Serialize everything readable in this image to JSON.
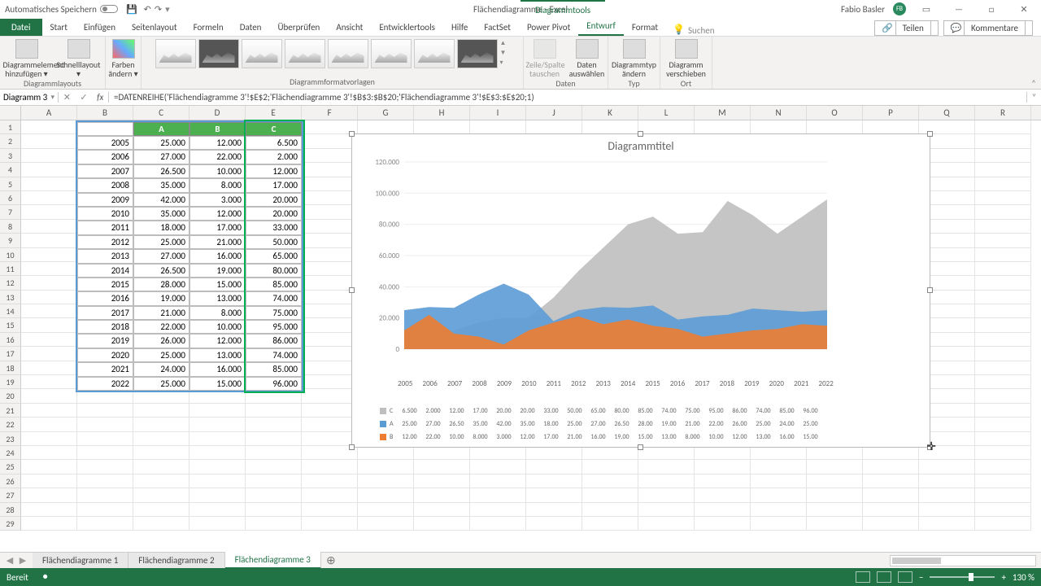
{
  "titlebar": {
    "autosave": "Automatisches Speichern",
    "title": "Flächendiagramme - Excel",
    "tools_tab": "Diagrammtools",
    "user": "Fabio Basler",
    "avatar": "FB"
  },
  "ribbon": {
    "tabs": [
      "Datei",
      "Start",
      "Einfügen",
      "Seitenlayout",
      "Formeln",
      "Daten",
      "Überprüfen",
      "Ansicht",
      "Entwicklertools",
      "Hilfe",
      "FactSet",
      "Power Pivot",
      "Entwurf",
      "Format"
    ],
    "active_tab": "Entwurf",
    "search": "Suchen",
    "share": "Teilen",
    "comments": "Kommentare",
    "groups": {
      "layouts": "Diagrammlayouts",
      "styles": "Diagrammformatvorlagen",
      "data": "Daten",
      "type": "Typ",
      "location": "Ort",
      "btn_addelement": "Diagrammelement hinzufügen",
      "btn_quicklayout": "Schnelllayout",
      "btn_colors": "Farben ändern",
      "btn_switch": "Zeile/Spalte tauschen",
      "btn_select": "Daten auswählen",
      "btn_changetype": "Diagrammtyp ändern",
      "btn_move": "Diagramm verschieben"
    }
  },
  "namebox": "Diagramm 3",
  "formula": "=DATENREIHE('Flächendiagramme 3'!$E$2;'Flächendiagramme 3'!$B$3:$B$20;'Flächendiagramme 3'!$E$3:$E$20;1)",
  "columns": [
    "A",
    "B",
    "C",
    "D",
    "E",
    "F",
    "G",
    "H",
    "I",
    "J",
    "K",
    "L",
    "M",
    "N",
    "O",
    "P",
    "Q",
    "R"
  ],
  "table": {
    "headers": [
      "A",
      "B",
      "C"
    ],
    "years": [
      2005,
      2006,
      2007,
      2008,
      2009,
      2010,
      2011,
      2012,
      2013,
      2014,
      2015,
      2016,
      2017,
      2018,
      2019,
      2020,
      2021,
      2022
    ],
    "A": [
      "25.000",
      "27.000",
      "26.500",
      "35.000",
      "42.000",
      "35.000",
      "18.000",
      "25.000",
      "27.000",
      "26.500",
      "28.000",
      "19.000",
      "21.000",
      "22.000",
      "26.000",
      "25.000",
      "24.000",
      "25.000"
    ],
    "B": [
      "12.000",
      "22.000",
      "10.000",
      "8.000",
      "3.000",
      "12.000",
      "17.000",
      "21.000",
      "16.000",
      "19.000",
      "15.000",
      "13.000",
      "8.000",
      "10.000",
      "12.000",
      "13.000",
      "16.000",
      "15.000"
    ],
    "C": [
      "6.500",
      "2.000",
      "12.000",
      "17.000",
      "20.000",
      "20.000",
      "33.000",
      "50.000",
      "65.000",
      "80.000",
      "85.000",
      "74.000",
      "75.000",
      "95.000",
      "86.000",
      "74.000",
      "85.000",
      "96.000"
    ]
  },
  "chart_data": {
    "type": "area",
    "title": "Diagrammtitel",
    "categories": [
      2005,
      2006,
      2007,
      2008,
      2009,
      2010,
      2011,
      2012,
      2013,
      2014,
      2015,
      2016,
      2017,
      2018,
      2019,
      2020,
      2021,
      2022
    ],
    "series": [
      {
        "name": "C",
        "color": "#bfbfbf",
        "values": [
          6500,
          2000,
          12000,
          17000,
          20000,
          20000,
          33000,
          50000,
          65000,
          80000,
          85000,
          74000,
          75000,
          95000,
          86000,
          74000,
          85000,
          96000
        ]
      },
      {
        "name": "A",
        "color": "#5b9bd5",
        "values": [
          25000,
          27000,
          26500,
          35000,
          42000,
          35000,
          18000,
          25000,
          27000,
          26500,
          28000,
          19000,
          21000,
          22000,
          26000,
          25000,
          24000,
          25000
        ]
      },
      {
        "name": "B",
        "color": "#ed7d31",
        "values": [
          12000,
          22000,
          10000,
          8000,
          3000,
          12000,
          17000,
          21000,
          16000,
          19000,
          15000,
          13000,
          8000,
          10000,
          12000,
          13000,
          16000,
          15000
        ]
      }
    ],
    "yticks": [
      "0",
      "20.000",
      "40.000",
      "60.000",
      "80.000",
      "100.000",
      "120.000"
    ],
    "ylim": [
      0,
      120000
    ],
    "data_table_rows": {
      "C": [
        "6.500",
        "2.000",
        "12.00",
        "17.00",
        "20.00",
        "20.00",
        "33.00",
        "50.00",
        "65.00",
        "80.00",
        "85.00",
        "74.00",
        "75.00",
        "95.00",
        "86.00",
        "74.00",
        "85.00",
        "96.00"
      ],
      "A": [
        "25.00",
        "27.00",
        "26.50",
        "35.00",
        "42.00",
        "35.00",
        "18.00",
        "25.00",
        "27.00",
        "26.50",
        "28.00",
        "19.00",
        "21.00",
        "22.00",
        "26.00",
        "25.00",
        "24.00",
        "25.00"
      ],
      "B": [
        "12.00",
        "22.00",
        "10.00",
        "8.000",
        "3.000",
        "12.00",
        "17.00",
        "21.00",
        "16.00",
        "19.00",
        "15.00",
        "13.00",
        "8.000",
        "10.00",
        "12.00",
        "13.00",
        "16.00",
        "15.00"
      ]
    }
  },
  "sheets": {
    "tabs": [
      "Flächendiagramme 1",
      "Flächendiagramme 2",
      "Flächendiagramme 3"
    ],
    "active": 2
  },
  "statusbar": {
    "ready": "Bereit",
    "zoom": "130 %"
  }
}
